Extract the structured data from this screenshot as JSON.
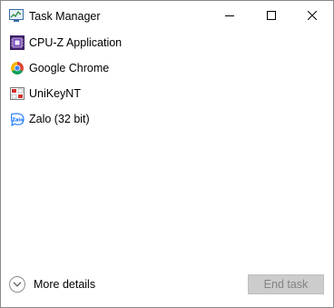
{
  "window": {
    "title": "Task Manager",
    "icon": "task-manager-icon"
  },
  "caption_buttons": {
    "minimize_icon": "minimize-icon",
    "maximize_icon": "maximize-icon",
    "close_icon": "close-icon"
  },
  "apps": [
    {
      "label": "CPU-Z Application",
      "icon": "cpu-z-icon"
    },
    {
      "label": "Google Chrome",
      "icon": "chrome-icon"
    },
    {
      "label": "UniKeyNT",
      "icon": "unikey-icon"
    },
    {
      "label": "Zalo (32 bit)",
      "icon": "zalo-icon"
    }
  ],
  "footer": {
    "more_details_label": "More details",
    "more_details_icon": "chevron-down-icon",
    "end_task_label": "End task",
    "end_task_enabled": false
  },
  "colors": {
    "accent_cpuz": "#5b2d8e",
    "chrome_red": "#db4437",
    "chrome_green": "#0f9d58",
    "chrome_yellow": "#f4b400",
    "chrome_blue": "#4285f4",
    "zalo_blue": "#0068ff",
    "disabled_button_bg": "#cccccc",
    "disabled_button_text": "#838383"
  }
}
